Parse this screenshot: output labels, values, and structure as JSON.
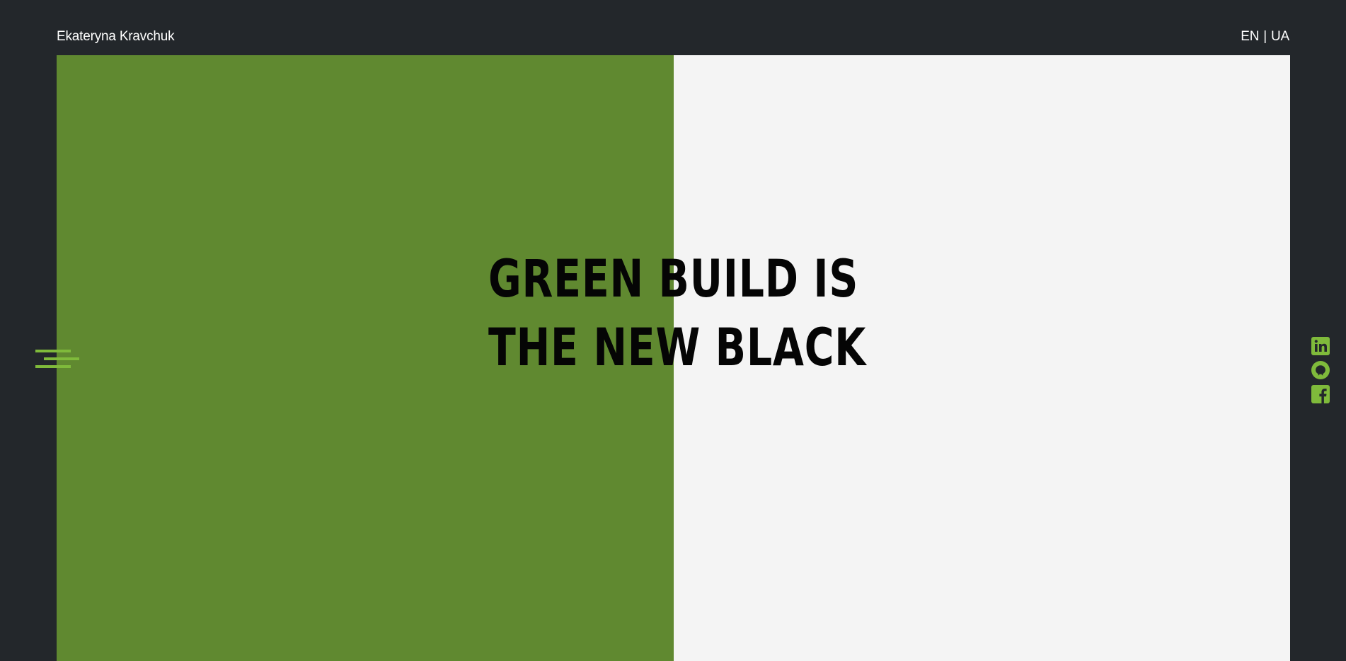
{
  "header": {
    "brand_name": "Ekateryna Kravchuk",
    "languages": [
      "EN",
      "UA"
    ],
    "language_separator": "|"
  },
  "hero": {
    "headline_line1": "GREEN BUILD IS",
    "headline_line2": "THE NEW BLACK",
    "left_panel_color": "#608930",
    "right_panel_color": "#f4f4f4"
  },
  "menu": {
    "icon": "hamburger-menu-icon",
    "accent_color": "#7fba3b"
  },
  "social_links": [
    {
      "icon": "linkedin-icon"
    },
    {
      "icon": "github-icon"
    },
    {
      "icon": "facebook-icon"
    }
  ],
  "colors": {
    "background": "#23272b",
    "accent": "#7fba3b",
    "text_dark": "#050505",
    "text_light": "#ffffff"
  }
}
